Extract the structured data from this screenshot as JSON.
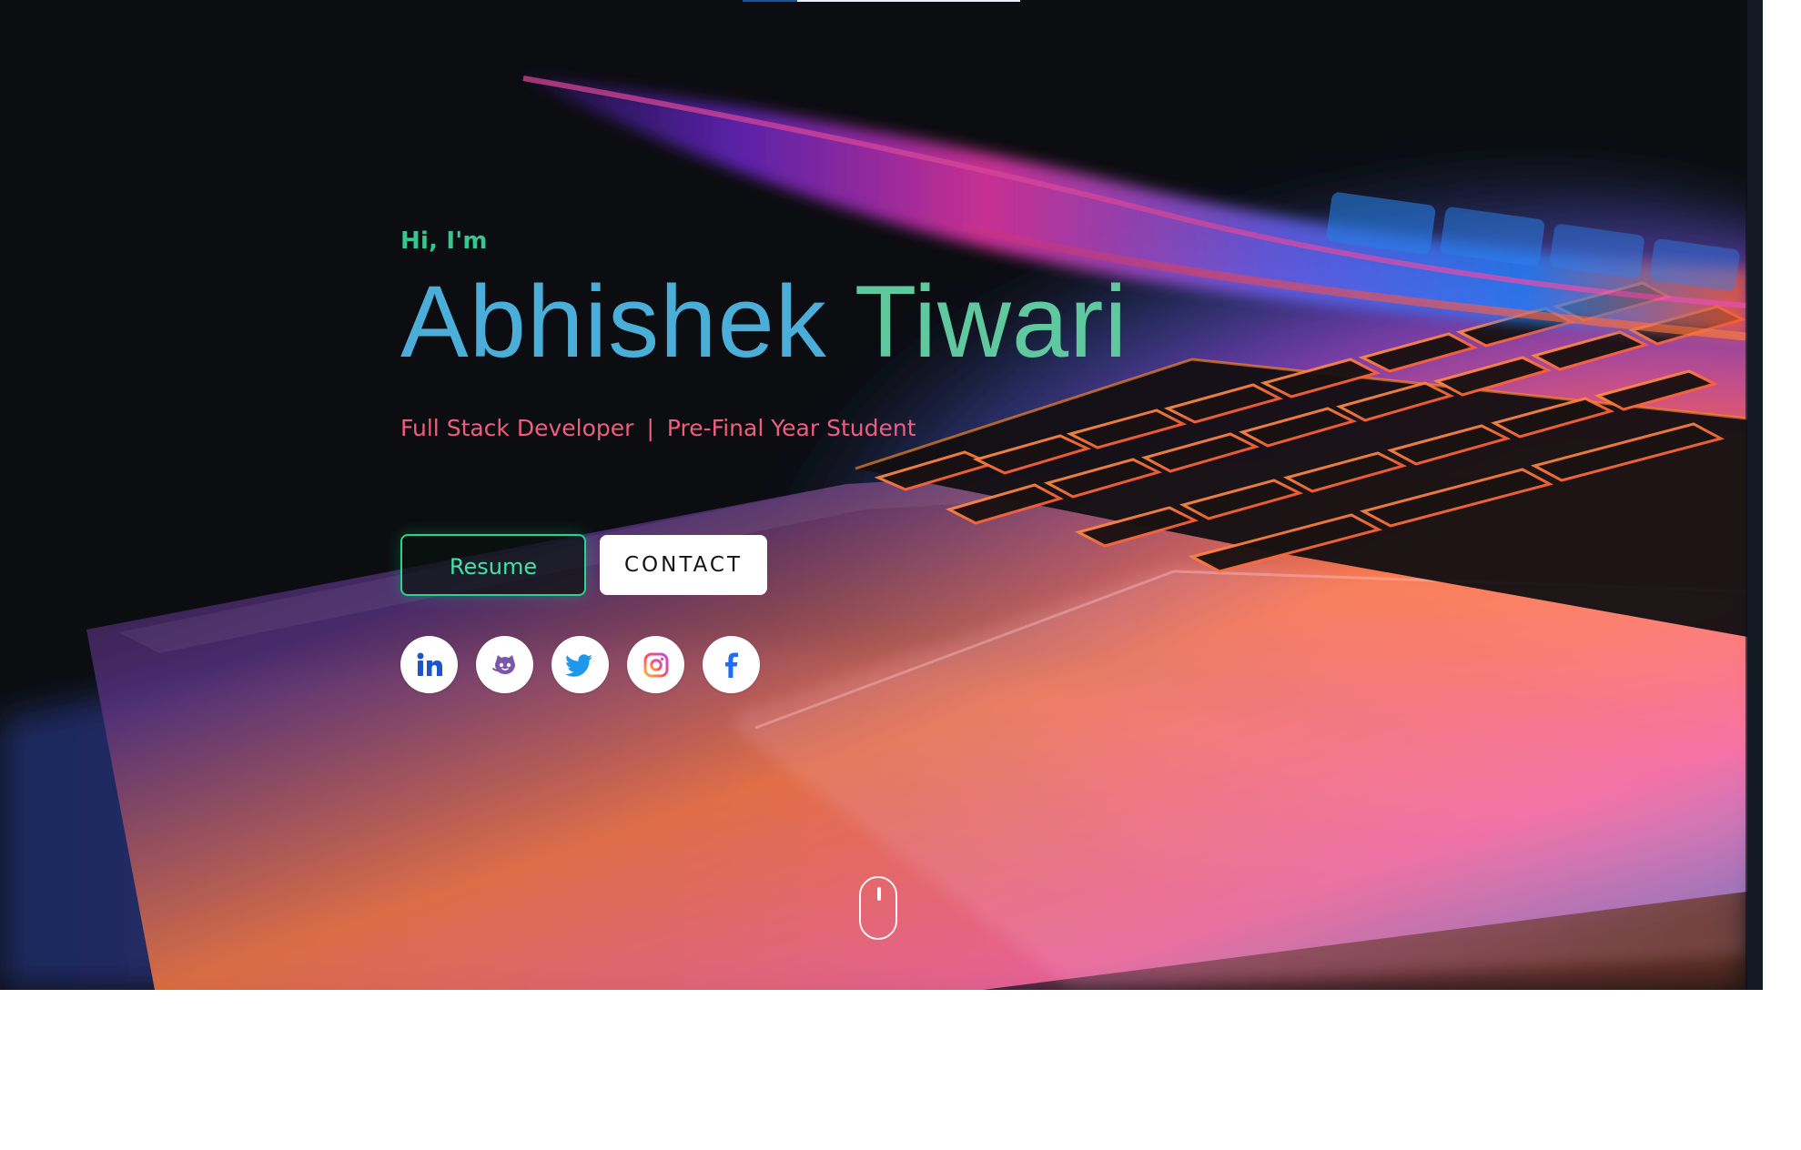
{
  "hero": {
    "greeting": "Hi, I'm",
    "first_name": "Abhishek",
    "last_name": "Tiwari",
    "roles": [
      "Full Stack Developer",
      "Pre-Final Year Student"
    ],
    "role_separator": "|",
    "buttons": {
      "resume": "Resume",
      "contact": "CONTACT"
    },
    "social_icons": [
      "linkedin-icon",
      "github-icon",
      "twitter-icon",
      "instagram-icon",
      "facebook-icon"
    ],
    "scroll_indicator_icon": "mouse-icon"
  },
  "colors": {
    "greeting": "#35c78f",
    "name_first": "#4aaed8",
    "name_last": "#60c89f",
    "subtitle": "#f05d7f",
    "resume_border": "#28d490",
    "contact_bg": "#ffffff",
    "page_background": "#ffffff"
  }
}
